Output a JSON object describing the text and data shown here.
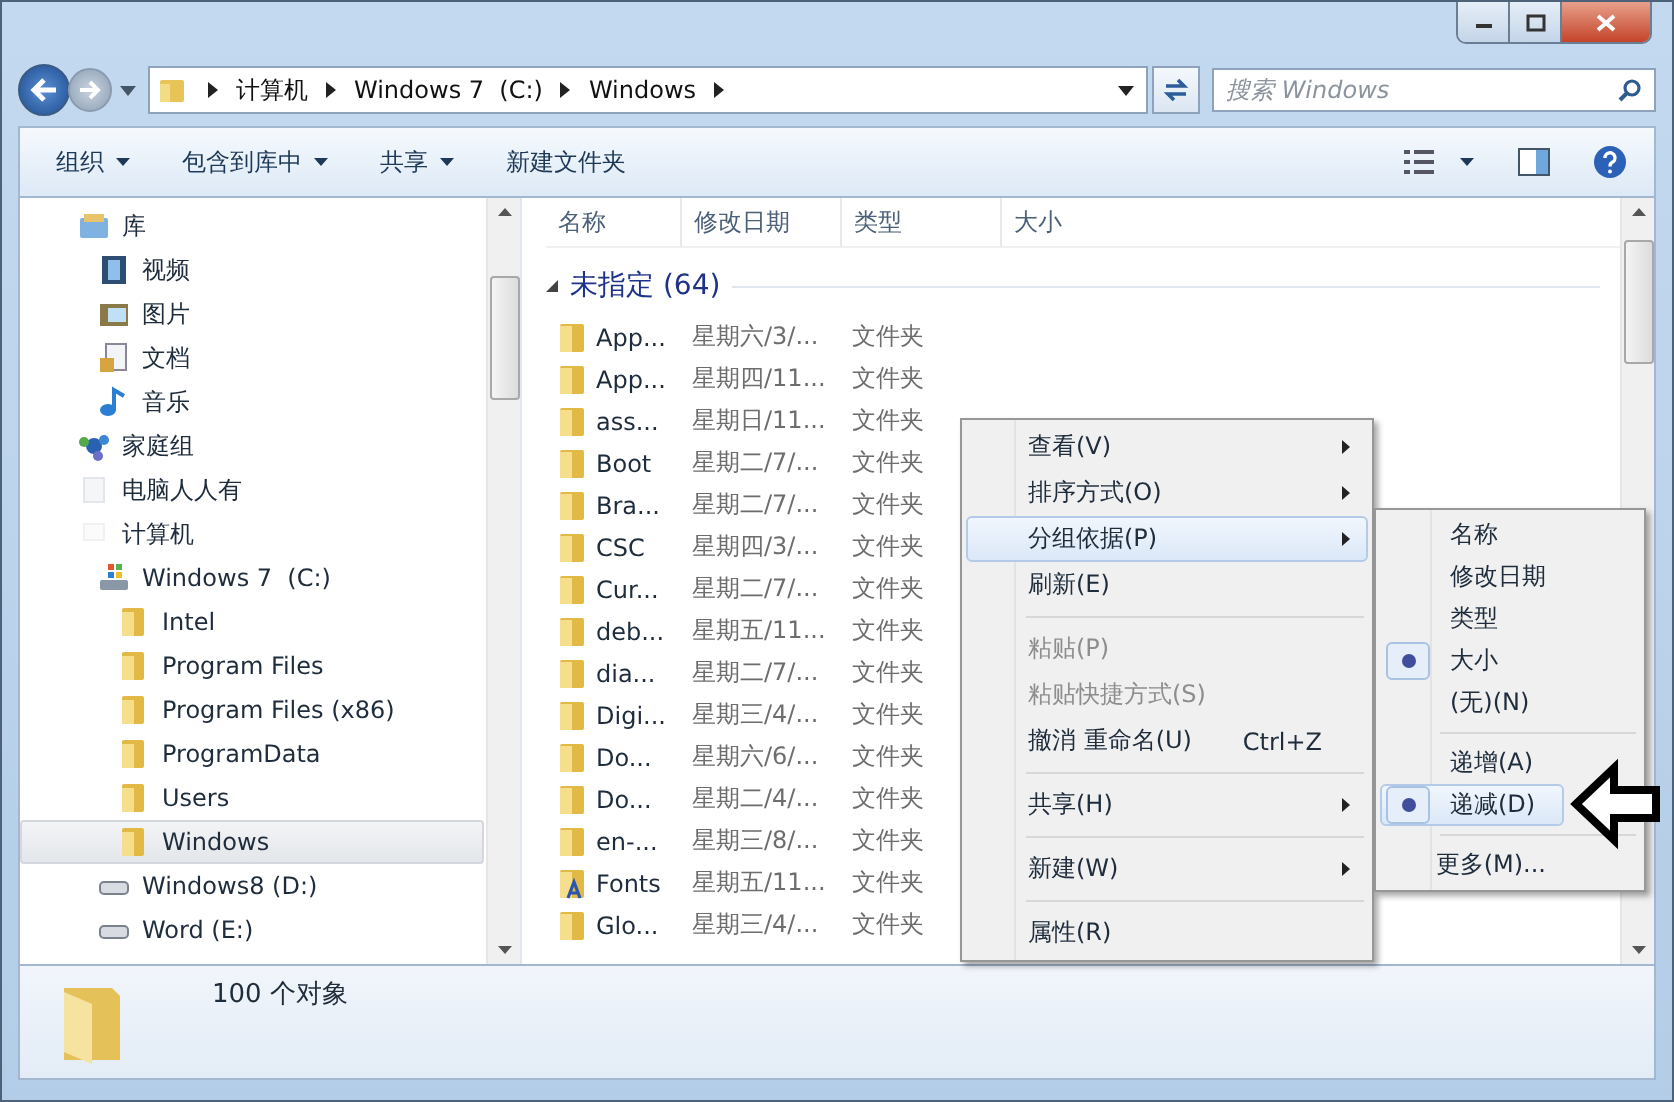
{
  "address": {
    "crumbs": [
      "计算机",
      "Windows 7  (C:)",
      "Windows"
    ]
  },
  "search": {
    "placeholder": "搜索 Windows"
  },
  "toolbar": {
    "buttons": [
      {
        "label": "组织",
        "dropdown": true
      },
      {
        "label": "包含到库中",
        "dropdown": true
      },
      {
        "label": "共享",
        "dropdown": true
      },
      {
        "label": "新建文件夹",
        "dropdown": false
      }
    ]
  },
  "nav": {
    "items": [
      {
        "label": "库",
        "kind": "library",
        "selected": false,
        "children": [
          {
            "label": "视频",
            "kind": "video",
            "selected": false
          },
          {
            "label": "图片",
            "kind": "picture",
            "selected": false
          },
          {
            "label": "文档",
            "kind": "document",
            "selected": false
          },
          {
            "label": "音乐",
            "kind": "music",
            "selected": false
          }
        ]
      },
      {
        "label": "家庭组",
        "kind": "homegroup",
        "selected": false
      },
      {
        "label": "电脑人人有",
        "kind": "user",
        "selected": false
      },
      {
        "label": "计算机",
        "kind": "computer",
        "selected": false,
        "children": [
          {
            "label": "Windows 7  (C:)",
            "kind": "systemdrive",
            "selected": false,
            "children": [
              {
                "label": "Intel",
                "kind": "folder",
                "selected": false
              },
              {
                "label": "Program Files",
                "kind": "folder",
                "selected": false
              },
              {
                "label": "Program Files (x86)",
                "kind": "folder",
                "selected": false
              },
              {
                "label": "ProgramData",
                "kind": "folder",
                "selected": false
              },
              {
                "label": "Users",
                "kind": "folder",
                "selected": false
              },
              {
                "label": "Windows",
                "kind": "folder",
                "selected": true
              }
            ]
          },
          {
            "label": "Windows8 (D:)",
            "kind": "drive",
            "selected": false
          },
          {
            "label": "Word (E:)",
            "kind": "drive",
            "selected": false
          }
        ]
      }
    ]
  },
  "file_list": {
    "columns": [
      "名称",
      "修改日期",
      "类型",
      "大小"
    ],
    "group": {
      "label": "未指定 (64)",
      "expanded": true
    },
    "rows": [
      {
        "name": "App...",
        "date": "星期六/3/...",
        "type": "文件夹",
        "kind": "folder"
      },
      {
        "name": "App...",
        "date": "星期四/11...",
        "type": "文件夹",
        "kind": "folder"
      },
      {
        "name": "ass...",
        "date": "星期日/11...",
        "type": "文件夹",
        "kind": "folder"
      },
      {
        "name": "Boot",
        "date": "星期二/7/...",
        "type": "文件夹",
        "kind": "folder"
      },
      {
        "name": "Bra...",
        "date": "星期二/7/...",
        "type": "文件夹",
        "kind": "folder"
      },
      {
        "name": "CSC",
        "date": "星期四/3/...",
        "type": "文件夹",
        "kind": "folder"
      },
      {
        "name": "Cur...",
        "date": "星期二/7/...",
        "type": "文件夹",
        "kind": "folder"
      },
      {
        "name": "deb...",
        "date": "星期五/11...",
        "type": "文件夹",
        "kind": "folder"
      },
      {
        "name": "dia...",
        "date": "星期二/7/...",
        "type": "文件夹",
        "kind": "folder"
      },
      {
        "name": "Digi...",
        "date": "星期三/4/...",
        "type": "文件夹",
        "kind": "folder"
      },
      {
        "name": "Do...",
        "date": "星期六/6/...",
        "type": "文件夹",
        "kind": "folder"
      },
      {
        "name": "Do...",
        "date": "星期二/4/...",
        "type": "文件夹",
        "kind": "folder"
      },
      {
        "name": "en-...",
        "date": "星期三/8/...",
        "type": "文件夹",
        "kind": "folder"
      },
      {
        "name": "Fonts",
        "date": "星期五/11...",
        "type": "文件夹",
        "kind": "fonts"
      },
      {
        "name": "Glo...",
        "date": "星期三/4/...",
        "type": "文件夹",
        "kind": "folder"
      }
    ]
  },
  "context_menu": {
    "items": [
      {
        "kind": "item",
        "label": "查看(V)",
        "submenu": true,
        "disabled": false,
        "highlighted": false
      },
      {
        "kind": "item",
        "label": "排序方式(O)",
        "submenu": true,
        "disabled": false,
        "highlighted": false
      },
      {
        "kind": "item",
        "label": "分组依据(P)",
        "submenu": true,
        "disabled": false,
        "highlighted": true
      },
      {
        "kind": "item",
        "label": "刷新(E)",
        "submenu": false,
        "disabled": false,
        "highlighted": false
      },
      {
        "kind": "separator"
      },
      {
        "kind": "item",
        "label": "粘贴(P)",
        "submenu": false,
        "disabled": true,
        "highlighted": false
      },
      {
        "kind": "item",
        "label": "粘贴快捷方式(S)",
        "submenu": false,
        "disabled": true,
        "highlighted": false
      },
      {
        "kind": "item",
        "label": "撤消 重命名(U)",
        "shortcut": "Ctrl+Z",
        "submenu": false,
        "disabled": false,
        "highlighted": false
      },
      {
        "kind": "separator"
      },
      {
        "kind": "item",
        "label": "共享(H)",
        "submenu": true,
        "disabled": false,
        "highlighted": false
      },
      {
        "kind": "separator"
      },
      {
        "kind": "item",
        "label": "新建(W)",
        "submenu": true,
        "disabled": false,
        "highlighted": false
      },
      {
        "kind": "separator"
      },
      {
        "kind": "item",
        "label": "属性(R)",
        "submenu": false,
        "disabled": false,
        "highlighted": false
      }
    ]
  },
  "submenu": {
    "items": [
      {
        "kind": "item",
        "label": "名称",
        "selected": false,
        "highlighted": false
      },
      {
        "kind": "item",
        "label": "修改日期",
        "selected": false,
        "highlighted": false
      },
      {
        "kind": "item",
        "label": "类型",
        "selected": false,
        "highlighted": false
      },
      {
        "kind": "item",
        "label": "大小",
        "selected": true,
        "highlighted": false
      },
      {
        "kind": "item",
        "label": "(无)(N)",
        "selected": false,
        "highlighted": false
      },
      {
        "kind": "separator"
      },
      {
        "kind": "item",
        "label": "递增(A)",
        "selected": false,
        "highlighted": false
      },
      {
        "kind": "item",
        "label": "递减(D)",
        "selected": true,
        "highlighted": true
      },
      {
        "kind": "separator"
      },
      {
        "kind": "item",
        "label": "更多(M)...",
        "selected": false,
        "highlighted": false
      }
    ]
  },
  "status_bar": {
    "text": "100 个对象"
  }
}
